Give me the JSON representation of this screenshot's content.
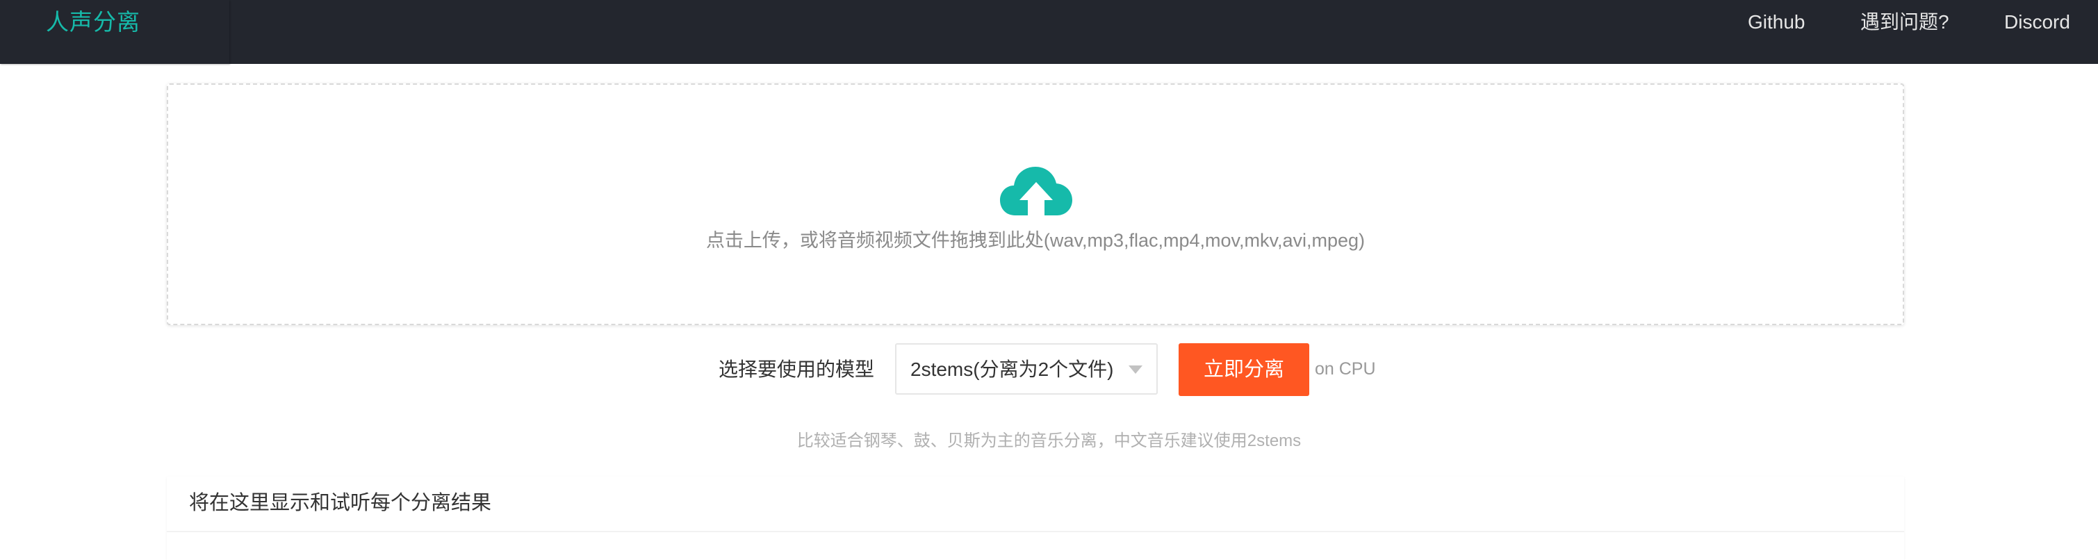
{
  "header": {
    "brand": "人声分离",
    "nav": {
      "github": "Github",
      "help": "遇到问题?",
      "discord": "Discord"
    }
  },
  "upload": {
    "icon": "cloud-upload-icon",
    "hint": "点击上传，或将音频视频文件拖拽到此处(wav,mp3,flac,mp4,mov,mkv,avi,mpeg)"
  },
  "model": {
    "label": "选择要使用的模型",
    "selected": "2stems(分离为2个文件)",
    "button": "立即分离",
    "device": "on CPU",
    "description": "比较适合钢琴、鼓、贝斯为主的音乐分离，中文音乐建议使用2stems"
  },
  "results": {
    "title": "将在这里显示和试听每个分离结果"
  },
  "colors": {
    "topbar": "#23262e",
    "brand": "#16baaa",
    "accent_button": "#ff5722",
    "icon": "#16baaa"
  }
}
